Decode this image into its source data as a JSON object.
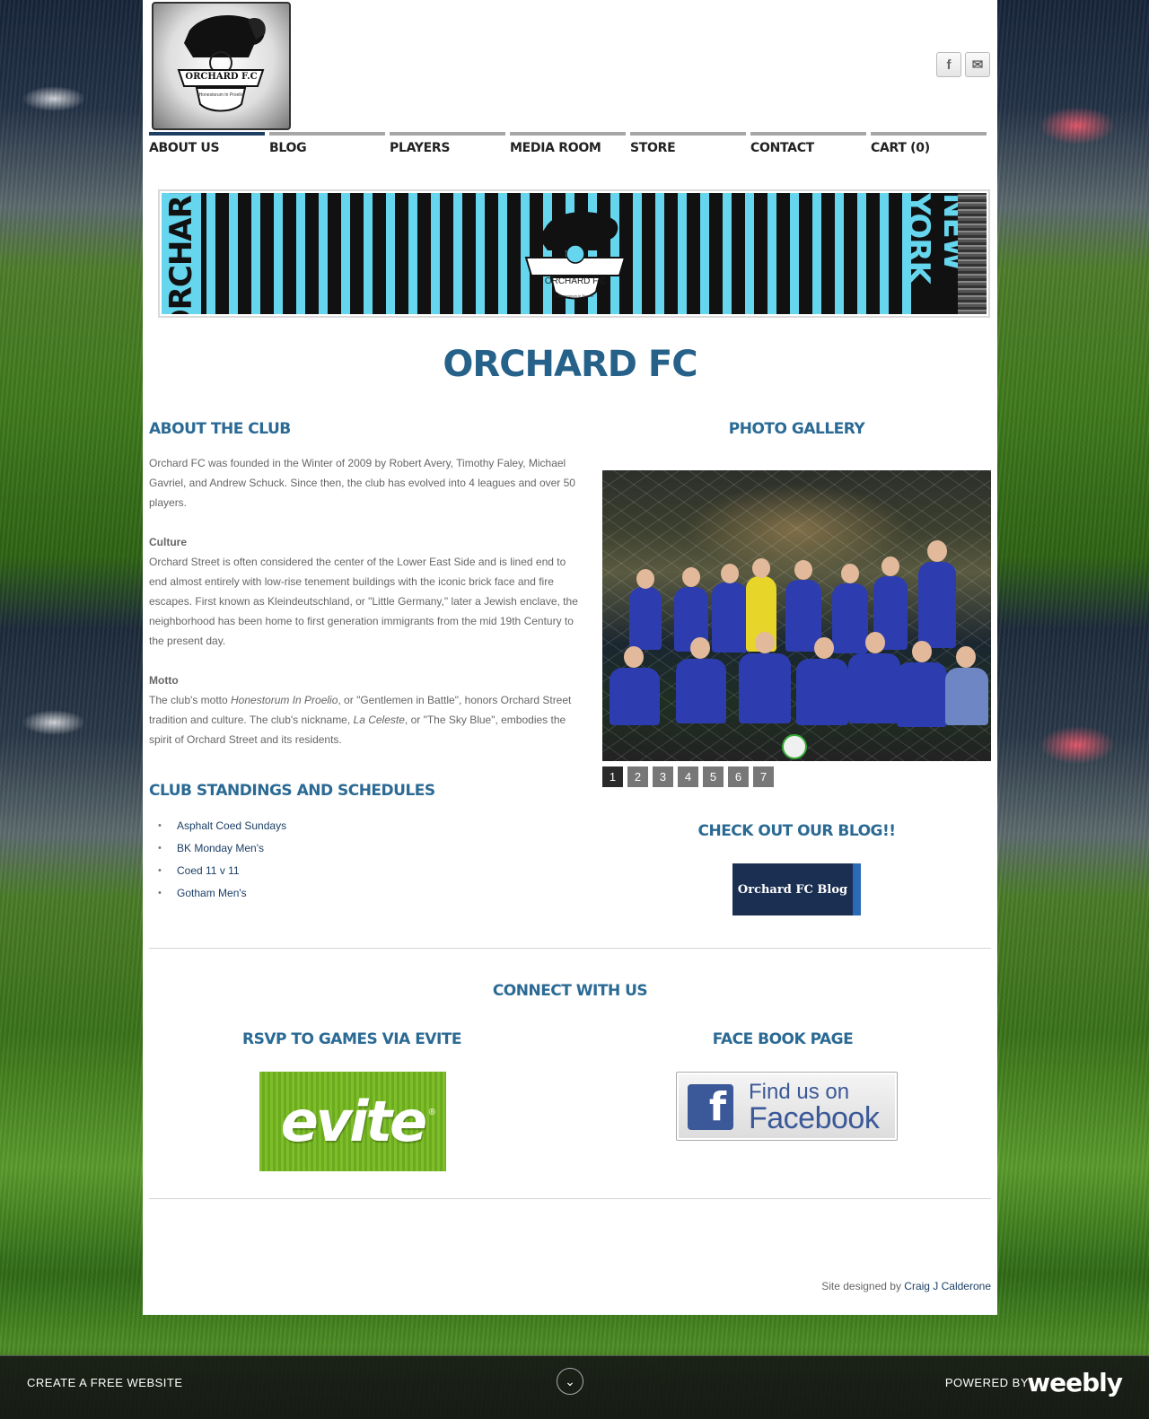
{
  "header": {
    "logo_text": "ORCHARD F.C",
    "logo_motto": "Honestorum In Proelio",
    "social": [
      {
        "icon": "facebook-icon",
        "glyph": "f"
      },
      {
        "icon": "mail-icon",
        "glyph": "✉"
      }
    ]
  },
  "nav": [
    {
      "label": "ABOUT US",
      "active": true
    },
    {
      "label": "BLOG"
    },
    {
      "label": "PLAYERS"
    },
    {
      "label": "MEDIA ROOM"
    },
    {
      "label": "STORE"
    },
    {
      "label": "CONTACT"
    },
    {
      "label": "CART (0)"
    }
  ],
  "banner": {
    "left_text": "ORCHARD",
    "right_text": "NEW YORK",
    "crest_text": "ORCHARD F.C",
    "crest_motto": "Honestorum In Proelio"
  },
  "title": "ORCHARD FC",
  "about": {
    "heading": "ABOUT THE CLUB",
    "intro": "Orchard FC was founded in the Winter of 2009 by Robert Avery, Timothy Faley, Michael Gavriel, and Andrew Schuck. Since then, the club has evolved into 4 leagues and over 50 players.",
    "culture_heading": "Culture",
    "culture_text": "Orchard Street is often considered the center of the Lower East Side and is lined end to end almost entirely with low-rise tenement buildings with the iconic brick face and fire escapes. First known as Kleindeutschland, or \"Little Germany,\" later a Jewish enclave, the neighborhood has been home to first generation immigrants from the mid 19th Century to the present day.",
    "motto_heading": "Motto",
    "motto_pre": "The club's motto ",
    "motto_latin": "Honestorum In Proelio",
    "motto_mid": ", or \"Gentlemen in Battle\",  honors Orchard Street tradition and culture. The club's nickname, ",
    "motto_nick": "La Celeste",
    "motto_post": ", or \"The Sky Blue\", embodies the spirit of Orchard Street and its residents."
  },
  "standings": {
    "heading": "CLUB STANDINGS AND SCHEDULES",
    "links": [
      "Asphalt Coed Sundays",
      "BK Monday Men's",
      "Coed 11 v 11",
      "Gotham Men's"
    ]
  },
  "gallery": {
    "heading": "PHOTO GALLERY",
    "pages": [
      "1",
      "2",
      "3",
      "4",
      "5",
      "6",
      "7"
    ],
    "current_page": "1"
  },
  "blog": {
    "heading": "CHECK OUT OUR BLOG!!",
    "button": "Orchard FC Blog"
  },
  "connect": {
    "heading": "CONNECT WITH US",
    "rsvp_heading": "RSVP TO GAMES VIA EVITE",
    "evite_logo": "evite",
    "evite_reg": "®",
    "fb_heading": "FACE BOOK PAGE",
    "fb_line1": "Find us on",
    "fb_line2": "Facebook",
    "fb_glyph": "f"
  },
  "credit": {
    "prefix": "Site designed by ",
    "author": "Craig J Calderone"
  },
  "footer": {
    "create": "CREATE A FREE WEBSITE",
    "powered": "POWERED BY",
    "brand": "weebly",
    "chevron": "⌄"
  },
  "colors": {
    "heading_blue": "#2b6a94",
    "banner_sky_blue": "#66d6ef",
    "link_navy": "#1c3f66",
    "blog_button": "#1a2f52"
  }
}
